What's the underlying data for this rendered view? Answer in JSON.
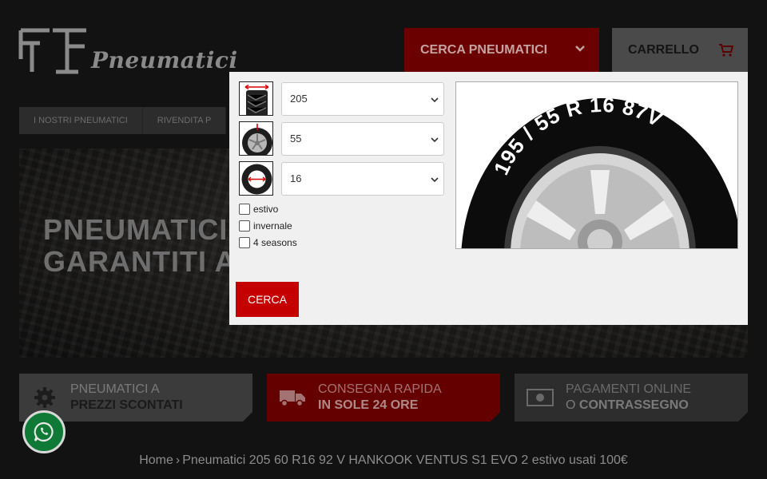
{
  "header": {
    "logo_text": "Pneumatici",
    "search_button": "CERCA PNEUMATICI",
    "cart_button": "CARRELLO"
  },
  "nav": {
    "items": [
      "I NOSTRI PNEUMATICI",
      "RIVENDITA P"
    ]
  },
  "hero": {
    "line1": "PNEUMATICI",
    "line2": "GARANTITI A"
  },
  "features": [
    {
      "line1": "PNEUMATICI A",
      "line2": "PREZZI SCONTATI",
      "icon": "gear-icon"
    },
    {
      "line1": "CONSEGNA RAPIDA",
      "line2": "IN SOLE 24 ORE",
      "icon": "truck-icon"
    },
    {
      "line1": "PAGAMENTI ONLINE",
      "line2_prefix": "O ",
      "line2": "CONTRASSEGNO",
      "icon": "banknote-icon"
    }
  ],
  "breadcrumb": {
    "home": "Home",
    "separator": "›",
    "current": "Pneumatici 205 60 R16 92 V HANKOOK VENTUS S1 EVO 2 estivo usati 100€"
  },
  "modal": {
    "width_select": "205",
    "ratio_select": "55",
    "rim_select": "16",
    "checkboxes": [
      {
        "label": "estivo",
        "checked": false
      },
      {
        "label": "invernale",
        "checked": false
      },
      {
        "label": "4 seasons",
        "checked": false
      }
    ],
    "submit_label": "CERCA",
    "tire_marking": "195 / 55 R 16 87V"
  },
  "colors": {
    "accent_red": "#c40000",
    "dark_red": "#650000",
    "modal_bg": "#f0f0f0"
  }
}
